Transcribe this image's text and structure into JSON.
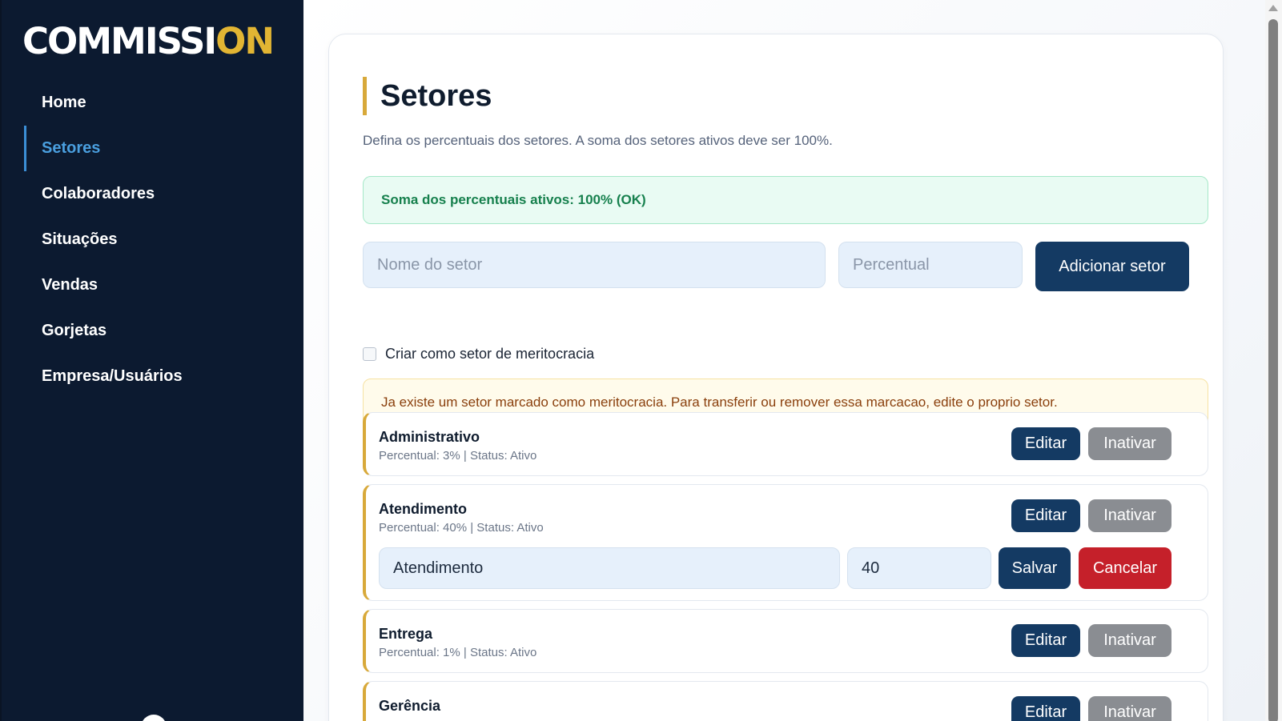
{
  "brand": {
    "logo_main": "COMMISSI",
    "logo_accent": "ON",
    "accent_color": "#e2b533"
  },
  "sidebar": {
    "items": [
      {
        "label": "Home",
        "active": false
      },
      {
        "label": "Setores",
        "active": true
      },
      {
        "label": "Colaboradores",
        "active": false
      },
      {
        "label": "Situações",
        "active": false
      },
      {
        "label": "Vendas",
        "active": false
      },
      {
        "label": "Gorjetas",
        "active": false
      },
      {
        "label": "Empresa/Usuários",
        "active": false
      }
    ]
  },
  "page": {
    "title": "Setores",
    "subtitle": "Defina os percentuais dos setores. A soma dos setores ativos deve ser 100%.",
    "sum_status": "Soma dos percentuais ativos: 100% (OK)"
  },
  "form": {
    "name_placeholder": "Nome do setor",
    "percent_placeholder": "Percentual",
    "add_label": "Adicionar setor",
    "meritocracy_checkbox_label": "Criar como setor de meritocracia",
    "meritocracy_checked": false
  },
  "warning": "Ja existe um setor marcado como meritocracia. Para transferir ou remover essa marcacao, edite o proprio setor.",
  "sectors": [
    {
      "name": "Administrativo",
      "meta": "Percentual: 3% | Status: Ativo",
      "edit_label": "Editar",
      "deactivate_label": "Inativar"
    },
    {
      "name": "Atendimento",
      "meta": "Percentual: 40% | Status: Ativo",
      "edit_label": "Editar",
      "deactivate_label": "Inativar",
      "editing": {
        "name_value": "Atendimento",
        "percent_value": "40",
        "save_label": "Salvar",
        "cancel_label": "Cancelar"
      }
    },
    {
      "name": "Entrega",
      "meta": "Percentual: 1% | Status: Ativo",
      "edit_label": "Editar",
      "deactivate_label": "Inativar"
    },
    {
      "name": "Gerência",
      "meta": "",
      "edit_label": "Editar",
      "deactivate_label": "Inativar"
    }
  ],
  "colors": {
    "sidebar_bg": "#0c1a30",
    "navy_button": "#143a63",
    "gray_button": "#8a8d92",
    "red_button": "#c5202a",
    "gold_accent": "#d8a93a",
    "active_nav": "#4a9fdf"
  }
}
